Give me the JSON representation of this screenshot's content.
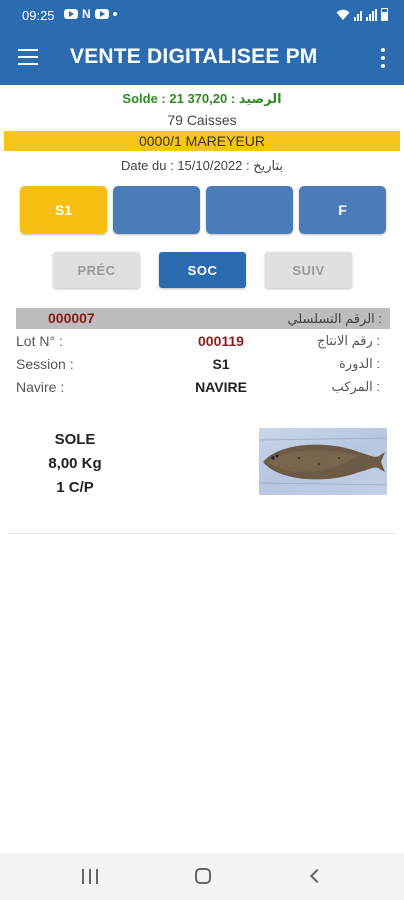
{
  "status_bar": {
    "time": "09:25",
    "notification_icons": [
      "youtube-icon",
      "n-icon",
      "youtube-icon",
      "dot-icon"
    ],
    "right_icons": [
      "wifi-icon",
      "signal-icon",
      "signal-icon",
      "battery-icon"
    ]
  },
  "app_bar": {
    "title": "VENTE DIGITALISEE PM",
    "menu_icon": "hamburger-menu-icon",
    "more_icon": "more-vertical-icon"
  },
  "summary": {
    "solde_label": "Solde : 21 370,20 : الرصيد",
    "caisses": "79 Caisses",
    "mareyeur": "0000/1 MAREYEUR",
    "date_label": "Date du : 15/10/2022 : بتاريخ"
  },
  "sessions": {
    "tabs": [
      {
        "label": "S1",
        "active": true
      },
      {
        "label": "",
        "active": false
      },
      {
        "label": "",
        "active": false
      },
      {
        "label": "F",
        "active": false
      }
    ]
  },
  "navigation": {
    "prev": "PRÉC",
    "current": "SOC",
    "next": "SUIV"
  },
  "lot": {
    "serial_value": "000007",
    "serial_label_ar": "الرقم التسلسلي :",
    "lot_label": "Lot N° :",
    "lot_value": "000119",
    "lot_label_ar": "رقم الانتاج :",
    "session_label": "Session :",
    "session_value": "S1",
    "session_label_ar": "الدورة :",
    "navire_label": "Navire :",
    "navire_value": "NAVIRE",
    "navire_label_ar": "المركب :"
  },
  "product": {
    "name": "SOLE",
    "weight": "8,00 Kg",
    "quantity": "1 C/P",
    "image": "sole-fish-photo"
  },
  "system_nav": {
    "icons": [
      "recent-apps-icon",
      "home-icon",
      "back-icon"
    ]
  },
  "colors": {
    "primary": "#2b6cb0",
    "accent_yellow": "#f7be12",
    "green_text": "#2e8b22",
    "serial_red": "#8b1a1a"
  }
}
